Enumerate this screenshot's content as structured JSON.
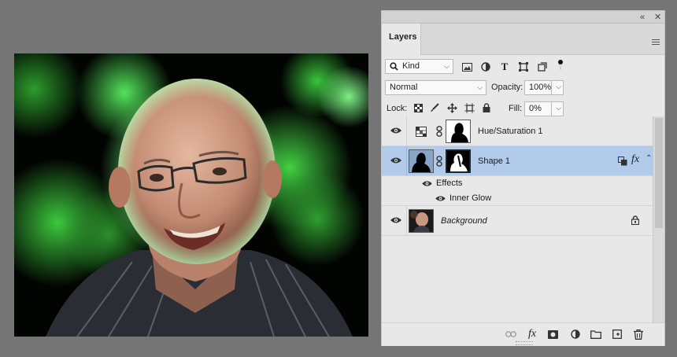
{
  "panel": {
    "tab": "Layers",
    "collapse_icon": "double-chevron-left-icon",
    "close_icon": "close-icon",
    "menu_icon": "hamburger-menu-icon"
  },
  "filter": {
    "kind_label": "Kind",
    "icons": [
      "pixel-filter-icon",
      "adjustment-filter-icon",
      "type-filter-icon",
      "shape-filter-icon",
      "smart-object-filter-icon"
    ]
  },
  "blend": {
    "mode": "Normal",
    "opacity_label": "Opacity:",
    "opacity": "100%"
  },
  "lock": {
    "label": "Lock:",
    "fill_label": "Fill:",
    "fill": "0%"
  },
  "layers": [
    {
      "name": "Hue/Saturation 1",
      "type": "adjustment",
      "visible": true
    },
    {
      "name": "Shape 1",
      "type": "shape",
      "selected": true,
      "visible": true,
      "effects_label": "Effects",
      "effect": "Inner Glow",
      "fx": "fx"
    },
    {
      "name": "Background",
      "type": "background",
      "locked": true,
      "visible": true
    }
  ],
  "footer": {
    "icons": [
      "link-layers-icon",
      "add-style-icon",
      "add-mask-icon",
      "new-adjustment-icon",
      "new-group-icon",
      "new-layer-icon",
      "delete-icon"
    ],
    "fx": "fx"
  },
  "colors": {
    "selection": "#b2cbeb",
    "glow": "#3cd23c"
  }
}
